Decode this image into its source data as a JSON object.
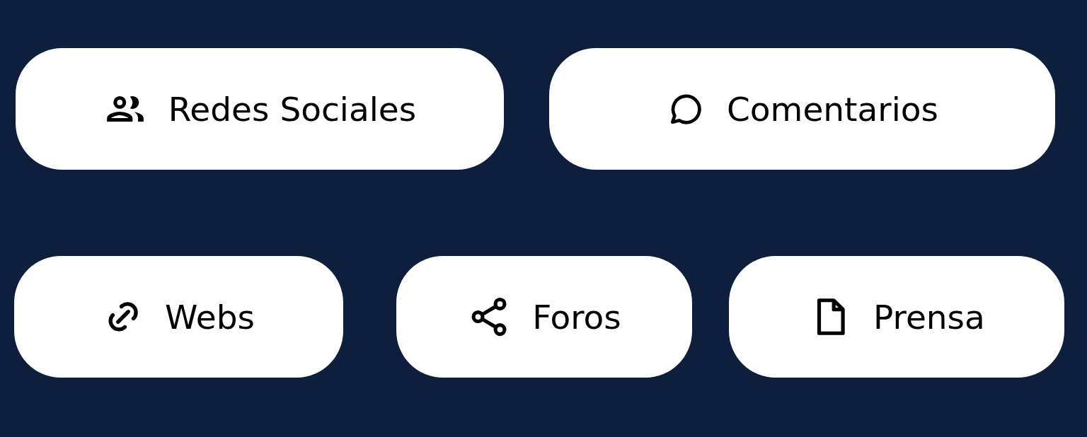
{
  "rows": [
    [
      {
        "label": "Redes Sociales",
        "kind": "people"
      },
      {
        "label": "Comentarios",
        "kind": "comment"
      }
    ],
    [
      {
        "label": "Webs",
        "kind": "link"
      },
      {
        "label": "Foros",
        "kind": "share"
      },
      {
        "label": "Prensa",
        "kind": "document"
      }
    ]
  ]
}
